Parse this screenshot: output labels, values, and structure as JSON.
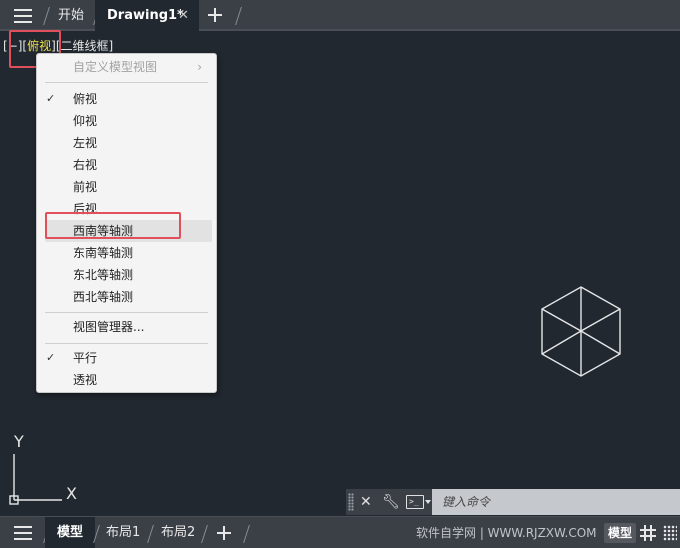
{
  "top_tabs": {
    "start": "开始",
    "drawing": "Drawing1*",
    "close": "✕"
  },
  "viewport": {
    "prefix": "[",
    "minus": "−",
    "bracket_mid": "][",
    "view": "俯视",
    "visual_style": "二维线框",
    "suffix": "]"
  },
  "menu": {
    "custom_views": "自定义模型视图",
    "views": [
      {
        "label": "俯视",
        "checked": true
      },
      {
        "label": "仰视",
        "checked": false
      },
      {
        "label": "左视",
        "checked": false
      },
      {
        "label": "右视",
        "checked": false
      },
      {
        "label": "前视",
        "checked": false
      },
      {
        "label": "后视",
        "checked": false
      },
      {
        "label": "西南等轴测",
        "checked": false
      },
      {
        "label": "东南等轴测",
        "checked": false
      },
      {
        "label": "东北等轴测",
        "checked": false
      },
      {
        "label": "西北等轴测",
        "checked": false
      }
    ],
    "view_manager": "视图管理器...",
    "parallel": "平行",
    "perspective": "透视"
  },
  "ucs": {
    "y": "Y",
    "x": "X"
  },
  "command": {
    "placeholder": "键入命令"
  },
  "bottom_tabs": {
    "model": "模型",
    "layout1": "布局1",
    "layout2": "布局2"
  },
  "status": {
    "watermark": "软件自学网 | WWW.RJZXW.COM",
    "model_button": "模型"
  },
  "colors": {
    "canvas": "#212830",
    "bar": "#3b4047",
    "highlight_text": "#f0e04c",
    "annotation_red": "#e0505a"
  }
}
